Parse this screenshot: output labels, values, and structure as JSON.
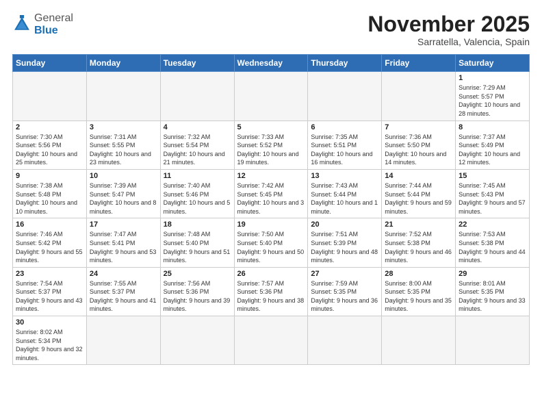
{
  "header": {
    "logo_general": "General",
    "logo_blue": "Blue",
    "month_title": "November 2025",
    "location": "Sarratella, Valencia, Spain"
  },
  "days_of_week": [
    "Sunday",
    "Monday",
    "Tuesday",
    "Wednesday",
    "Thursday",
    "Friday",
    "Saturday"
  ],
  "weeks": [
    [
      null,
      null,
      null,
      null,
      null,
      null,
      {
        "day": "1",
        "sunrise": "Sunrise: 7:29 AM",
        "sunset": "Sunset: 5:57 PM",
        "daylight": "Daylight: 10 hours and 28 minutes."
      }
    ],
    [
      {
        "day": "2",
        "sunrise": "Sunrise: 7:30 AM",
        "sunset": "Sunset: 5:56 PM",
        "daylight": "Daylight: 10 hours and 25 minutes."
      },
      {
        "day": "3",
        "sunrise": "Sunrise: 7:31 AM",
        "sunset": "Sunset: 5:55 PM",
        "daylight": "Daylight: 10 hours and 23 minutes."
      },
      {
        "day": "4",
        "sunrise": "Sunrise: 7:32 AM",
        "sunset": "Sunset: 5:54 PM",
        "daylight": "Daylight: 10 hours and 21 minutes."
      },
      {
        "day": "5",
        "sunrise": "Sunrise: 7:33 AM",
        "sunset": "Sunset: 5:52 PM",
        "daylight": "Daylight: 10 hours and 19 minutes."
      },
      {
        "day": "6",
        "sunrise": "Sunrise: 7:35 AM",
        "sunset": "Sunset: 5:51 PM",
        "daylight": "Daylight: 10 hours and 16 minutes."
      },
      {
        "day": "7",
        "sunrise": "Sunrise: 7:36 AM",
        "sunset": "Sunset: 5:50 PM",
        "daylight": "Daylight: 10 hours and 14 minutes."
      },
      {
        "day": "8",
        "sunrise": "Sunrise: 7:37 AM",
        "sunset": "Sunset: 5:49 PM",
        "daylight": "Daylight: 10 hours and 12 minutes."
      }
    ],
    [
      {
        "day": "9",
        "sunrise": "Sunrise: 7:38 AM",
        "sunset": "Sunset: 5:48 PM",
        "daylight": "Daylight: 10 hours and 10 minutes."
      },
      {
        "day": "10",
        "sunrise": "Sunrise: 7:39 AM",
        "sunset": "Sunset: 5:47 PM",
        "daylight": "Daylight: 10 hours and 8 minutes."
      },
      {
        "day": "11",
        "sunrise": "Sunrise: 7:40 AM",
        "sunset": "Sunset: 5:46 PM",
        "daylight": "Daylight: 10 hours and 5 minutes."
      },
      {
        "day": "12",
        "sunrise": "Sunrise: 7:42 AM",
        "sunset": "Sunset: 5:45 PM",
        "daylight": "Daylight: 10 hours and 3 minutes."
      },
      {
        "day": "13",
        "sunrise": "Sunrise: 7:43 AM",
        "sunset": "Sunset: 5:44 PM",
        "daylight": "Daylight: 10 hours and 1 minute."
      },
      {
        "day": "14",
        "sunrise": "Sunrise: 7:44 AM",
        "sunset": "Sunset: 5:44 PM",
        "daylight": "Daylight: 9 hours and 59 minutes."
      },
      {
        "day": "15",
        "sunrise": "Sunrise: 7:45 AM",
        "sunset": "Sunset: 5:43 PM",
        "daylight": "Daylight: 9 hours and 57 minutes."
      }
    ],
    [
      {
        "day": "16",
        "sunrise": "Sunrise: 7:46 AM",
        "sunset": "Sunset: 5:42 PM",
        "daylight": "Daylight: 9 hours and 55 minutes."
      },
      {
        "day": "17",
        "sunrise": "Sunrise: 7:47 AM",
        "sunset": "Sunset: 5:41 PM",
        "daylight": "Daylight: 9 hours and 53 minutes."
      },
      {
        "day": "18",
        "sunrise": "Sunrise: 7:48 AM",
        "sunset": "Sunset: 5:40 PM",
        "daylight": "Daylight: 9 hours and 51 minutes."
      },
      {
        "day": "19",
        "sunrise": "Sunrise: 7:50 AM",
        "sunset": "Sunset: 5:40 PM",
        "daylight": "Daylight: 9 hours and 50 minutes."
      },
      {
        "day": "20",
        "sunrise": "Sunrise: 7:51 AM",
        "sunset": "Sunset: 5:39 PM",
        "daylight": "Daylight: 9 hours and 48 minutes."
      },
      {
        "day": "21",
        "sunrise": "Sunrise: 7:52 AM",
        "sunset": "Sunset: 5:38 PM",
        "daylight": "Daylight: 9 hours and 46 minutes."
      },
      {
        "day": "22",
        "sunrise": "Sunrise: 7:53 AM",
        "sunset": "Sunset: 5:38 PM",
        "daylight": "Daylight: 9 hours and 44 minutes."
      }
    ],
    [
      {
        "day": "23",
        "sunrise": "Sunrise: 7:54 AM",
        "sunset": "Sunset: 5:37 PM",
        "daylight": "Daylight: 9 hours and 43 minutes."
      },
      {
        "day": "24",
        "sunrise": "Sunrise: 7:55 AM",
        "sunset": "Sunset: 5:37 PM",
        "daylight": "Daylight: 9 hours and 41 minutes."
      },
      {
        "day": "25",
        "sunrise": "Sunrise: 7:56 AM",
        "sunset": "Sunset: 5:36 PM",
        "daylight": "Daylight: 9 hours and 39 minutes."
      },
      {
        "day": "26",
        "sunrise": "Sunrise: 7:57 AM",
        "sunset": "Sunset: 5:36 PM",
        "daylight": "Daylight: 9 hours and 38 minutes."
      },
      {
        "day": "27",
        "sunrise": "Sunrise: 7:59 AM",
        "sunset": "Sunset: 5:35 PM",
        "daylight": "Daylight: 9 hours and 36 minutes."
      },
      {
        "day": "28",
        "sunrise": "Sunrise: 8:00 AM",
        "sunset": "Sunset: 5:35 PM",
        "daylight": "Daylight: 9 hours and 35 minutes."
      },
      {
        "day": "29",
        "sunrise": "Sunrise: 8:01 AM",
        "sunset": "Sunset: 5:35 PM",
        "daylight": "Daylight: 9 hours and 33 minutes."
      }
    ],
    [
      {
        "day": "30",
        "sunrise": "Sunrise: 8:02 AM",
        "sunset": "Sunset: 5:34 PM",
        "daylight": "Daylight: 9 hours and 32 minutes."
      },
      null,
      null,
      null,
      null,
      null,
      null
    ]
  ]
}
